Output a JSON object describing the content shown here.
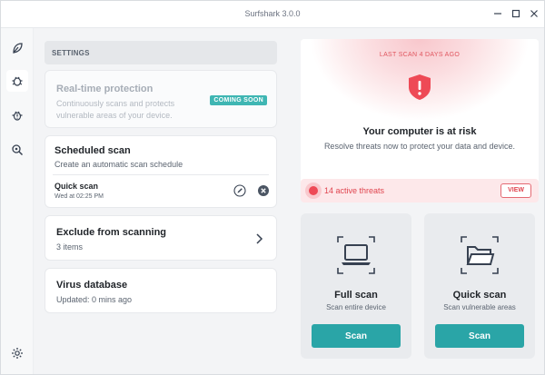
{
  "window": {
    "title": "Surfshark 3.0.0"
  },
  "sidebar": {
    "items": [
      {
        "icon": "leaf-icon"
      },
      {
        "icon": "bug-icon"
      },
      {
        "icon": "bug-alert-icon"
      },
      {
        "icon": "search-bug-icon"
      },
      {
        "icon": "gear-icon"
      }
    ]
  },
  "settings": {
    "header": "SETTINGS",
    "realtime": {
      "title": "Real-time protection",
      "description": "Continuously scans and protects vulnerable areas of your device.",
      "badge": "COMING SOON"
    },
    "scheduled": {
      "title": "Scheduled scan",
      "description": "Create an automatic scan schedule",
      "item_title": "Quick scan",
      "item_time": "Wed at 02:25 PM"
    },
    "exclude": {
      "title": "Exclude from scanning",
      "count": "3 items"
    },
    "database": {
      "title": "Virus database",
      "updated": "Updated: 0 mins ago"
    }
  },
  "status": {
    "last_scan": "LAST SCAN 4 DAYS AGO",
    "title": "Your computer is at risk",
    "subtitle": "Resolve threats now to protect your data and device.",
    "threats_label": "14 active threats",
    "view_label": "VIEW"
  },
  "scans": {
    "full": {
      "title": "Full scan",
      "subtitle": "Scan entire device",
      "button": "Scan"
    },
    "quick": {
      "title": "Quick scan",
      "subtitle": "Scan vulnerable areas",
      "button": "Scan"
    }
  },
  "colors": {
    "accent": "#2aa5a7",
    "danger": "#ee4a56",
    "badge": "#3fb6b3"
  }
}
